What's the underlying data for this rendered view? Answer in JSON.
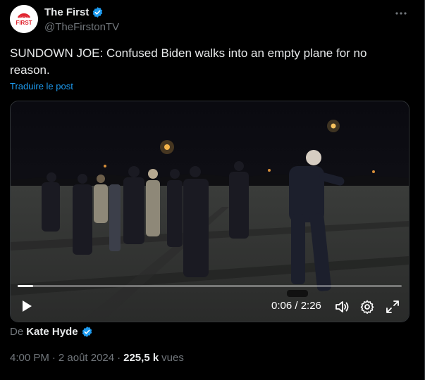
{
  "author": {
    "display_name": "The First",
    "handle": "@TheFirstonTV",
    "avatar_text": "FIRST",
    "verified_color": "#1d9bf0",
    "avatar_accent": "#e0202b"
  },
  "post": {
    "text": "SUNDOWN JOE: Confused Biden walks into an empty plane for no reason.",
    "translate_label": "Traduire le post"
  },
  "video": {
    "current_time": "0:06",
    "duration": "2:26",
    "time_display": "0:06 / 2:26",
    "progress_fraction": 0.041
  },
  "attribution": {
    "prefix": "De",
    "name": "Kate Hyde"
  },
  "meta": {
    "time": "4:00 PM",
    "separator": "·",
    "date": "2 août 2024",
    "views_count": "225,5 k",
    "views_label": "vues"
  },
  "colors": {
    "background": "#000000",
    "text_primary": "#e7e9ea",
    "text_secondary": "#71767b",
    "link": "#1d9bf0"
  },
  "icons": [
    "verified-icon",
    "more-icon",
    "play-icon",
    "volume-icon",
    "settings-icon",
    "fullscreen-icon"
  ]
}
